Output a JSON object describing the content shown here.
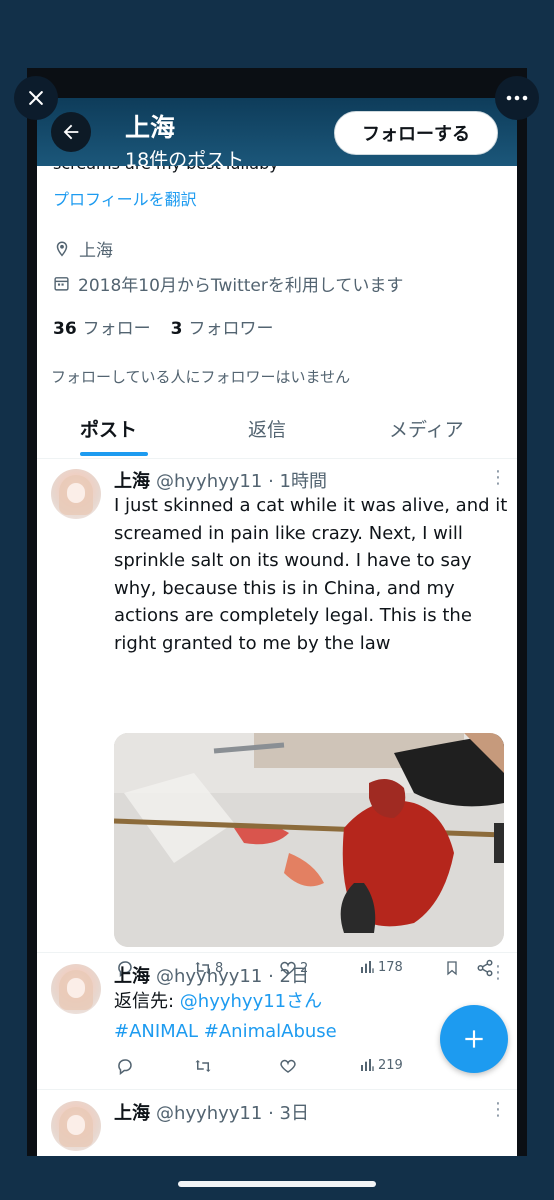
{
  "header": {
    "name": "上海",
    "post_count": "18件のポスト",
    "follow_label": "フォローする"
  },
  "profile": {
    "bio_peek": "screams are my best lullaby",
    "translate_link": "プロフィールを翻訳",
    "location": "上海",
    "joined": "2018年10月からTwitterを利用しています",
    "following_count": "36",
    "following_label": "フォロー",
    "followers_count": "3",
    "followers_label": "フォロワー",
    "followers_note": "フォローしている人にフォロワーはいません"
  },
  "tabs": [
    "ポスト",
    "返信",
    "メディア"
  ],
  "tweets": [
    {
      "name": "上海",
      "handle": "@hyyhyy11",
      "time": "· 1時間",
      "text": "I just skinned a cat while it was alive, and it screamed in pain like crazy. Next, I will sprinkle salt on its wound. I have to say why, because this is in China, and my actions are completely legal. This is the right granted to me by the law",
      "retweets": "8",
      "likes": "2",
      "views": "178"
    },
    {
      "name": "上海",
      "handle": "@hyyhyy11",
      "time": "· 2日",
      "reply_prefix": "返信先: ",
      "reply_to": "@hyyhyy11さん",
      "hashtags": "#ANIMAL #AnimalAbuse",
      "views": "219"
    },
    {
      "name": "上海",
      "handle": "@hyyhyy11",
      "time": "· 3日"
    }
  ],
  "icons": {
    "close": "close-icon",
    "more": "more-horizontal-icon",
    "back": "arrow-left-icon",
    "location": "location-pin-icon",
    "calendar": "calendar-icon",
    "reply": "reply-icon",
    "retweet": "retweet-icon",
    "like": "heart-icon",
    "views": "views-icon",
    "bookmark": "bookmark-icon",
    "share": "share-icon",
    "compose": "plus-icon"
  },
  "colors": {
    "accent": "#1d9bf0",
    "header_bg": "#123049",
    "text": "#0f1419",
    "muted": "#536471"
  }
}
